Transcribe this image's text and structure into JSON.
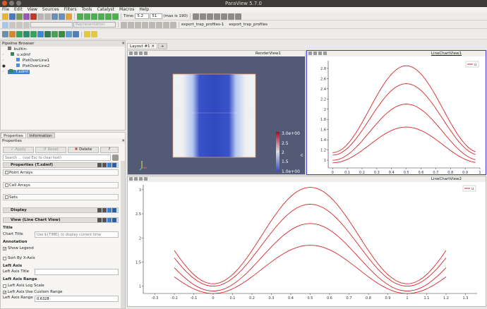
{
  "window": {
    "title": "ParaView 5.7.0"
  },
  "menu": [
    "File",
    "Edit",
    "View",
    "Sources",
    "Filters",
    "Tools",
    "Catalyst",
    "Macros",
    "Help"
  ],
  "toolbar": {
    "time_label": "Time:",
    "time_value": "5.2",
    "time_index": "51",
    "time_max": "(max is 190)",
    "representation_placeholder": "Representation",
    "macros": [
      "export_trap_profiles-1",
      "export_trap_profiles"
    ]
  },
  "pipeline": {
    "title": "Pipeline Browser",
    "items": [
      {
        "label": "builtin:"
      },
      {
        "label": "u.xdmf"
      },
      {
        "label": "PlotOverLine1"
      },
      {
        "label": "PlotOverLine2"
      },
      {
        "label": "T.xdmf"
      }
    ]
  },
  "props": {
    "tabs": [
      "Properties",
      "Information"
    ],
    "panel_title": "Properties",
    "apply": "Apply",
    "reset": "Reset",
    "delete": "Delete",
    "help": "?",
    "search_placeholder": "Search ... (use Esc to clear text)",
    "properties_section": "Properties (T.xdmf)",
    "point_arrays": "Point Arrays",
    "cell_arrays": "Cell Arrays",
    "sets": "Sets",
    "display_section": "Display",
    "view_section": "View (Line Chart View)",
    "title_header": "Title",
    "chart_title_label": "Chart Title",
    "chart_title_placeholder": "Use ${TIME} to display current time",
    "annotation_header": "Annotation",
    "show_legend": "Show Legend",
    "sort_by_x": "Sort By X-Axis",
    "left_axis_header": "Left Axis",
    "left_axis_title": "Left Axis Title",
    "left_axis_range_header": "Left Axis Range",
    "left_axis_log": "Left Axis Log Scale",
    "left_axis_custom": "Left Axis Use Custom Range",
    "left_axis_range_label": "Left Axis Range",
    "left_axis_range_value": "0.6328"
  },
  "layout": {
    "tab": "Layout #1",
    "add_tab": "+"
  },
  "render_view": {
    "title": "RenderView1",
    "legend_label": "u",
    "legend_ticks": [
      "3.0e+00",
      "2.5",
      "2",
      "1.5",
      "1.0e+00"
    ]
  },
  "chart1": {
    "title": "LineChartView1",
    "legend": "u",
    "yticks": [
      "2.8",
      "2.6",
      "2.4",
      "2.2",
      "2",
      "1.8",
      "1.6",
      "1.4",
      "1.2",
      "1"
    ],
    "xticks": [
      "0",
      "0.1",
      "0.2",
      "0.3",
      "0.4",
      "0.5",
      "0.6",
      "0.7",
      "0.8",
      "0.9",
      "1"
    ]
  },
  "chart2": {
    "title": "LineChartView2",
    "legend": "u",
    "yticks": [
      "3",
      "2.5",
      "2",
      "1.5",
      "1"
    ],
    "xticks": [
      "-0.3",
      "-0.2",
      "-0.1",
      "0",
      "0.1",
      "0.2",
      "0.3",
      "0.4",
      "0.5",
      "0.6",
      "0.7",
      "0.8",
      "0.9",
      "1",
      "1.1",
      "1.2",
      "1.3"
    ]
  },
  "colors": {
    "series": "#d62728",
    "active_view_border": "#3a3ae0"
  }
}
